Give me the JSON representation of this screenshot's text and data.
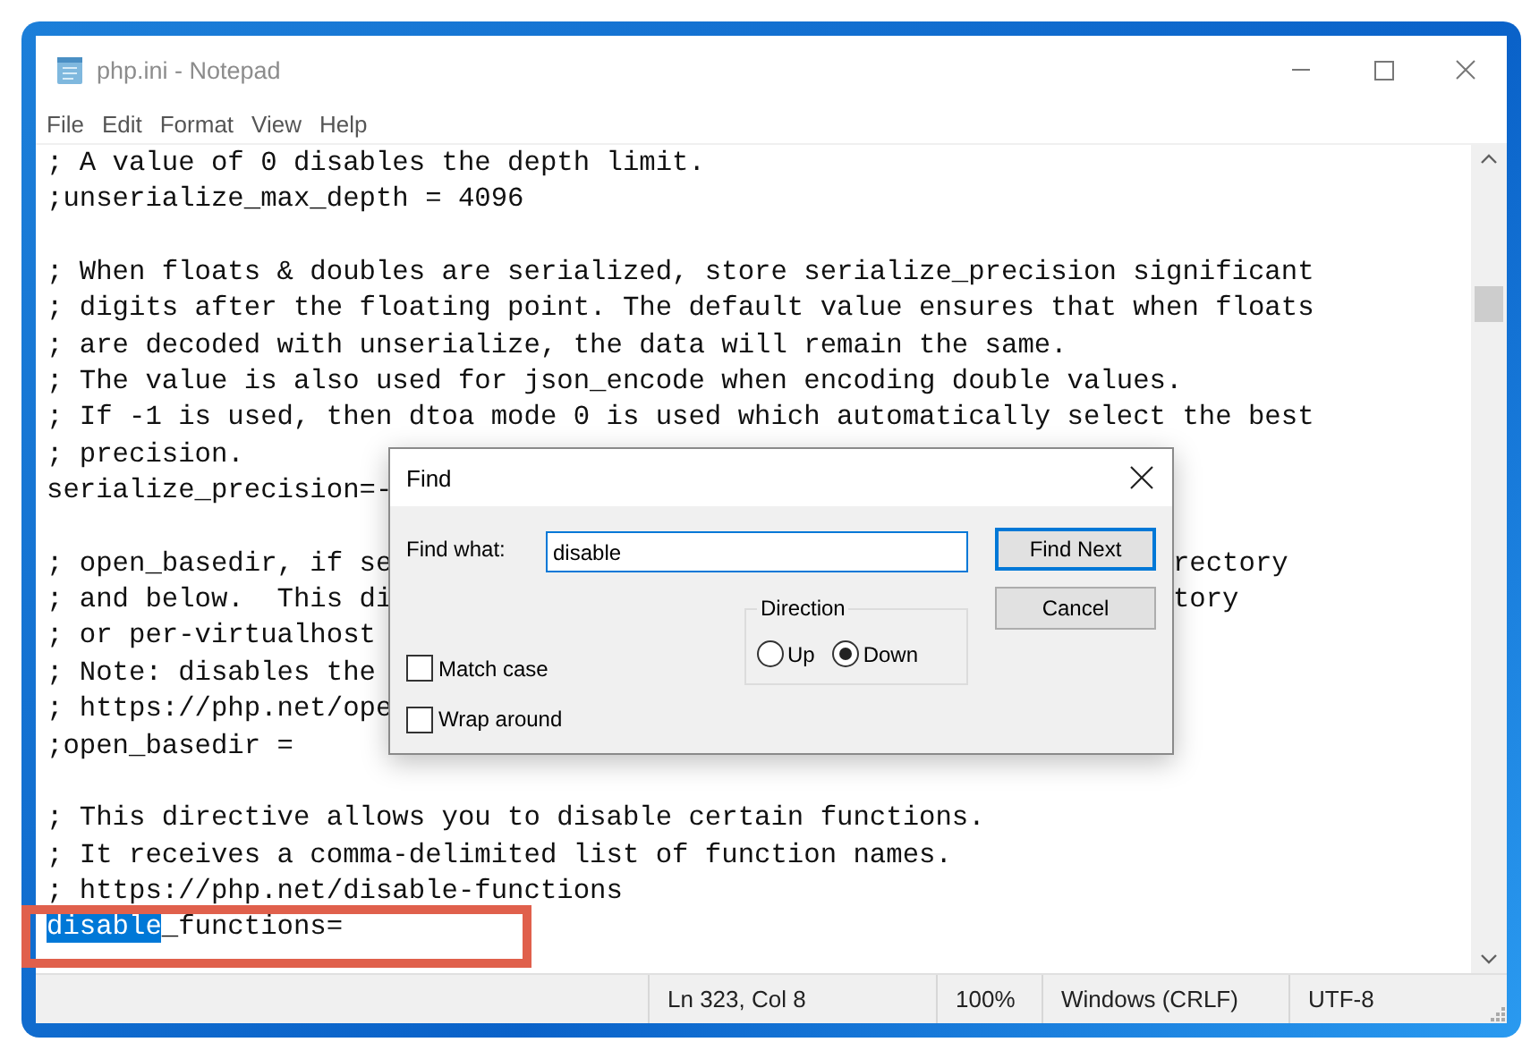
{
  "window": {
    "title": "php.ini - Notepad"
  },
  "menu": [
    "File",
    "Edit",
    "Format",
    "View",
    "Help"
  ],
  "editor": {
    "lines": [
      {
        "kind": "text",
        "text": "; A value of 0 disables the depth limit."
      },
      {
        "kind": "text",
        "text": ";unserialize_max_depth = 4096"
      },
      {
        "kind": "blank"
      },
      {
        "kind": "text",
        "text": "; When floats & doubles are serialized, store serialize_precision significant"
      },
      {
        "kind": "text",
        "text": "; digits after the floating point. The default value ensures that when floats"
      },
      {
        "kind": "text",
        "text": "; are decoded with unserialize, the data will remain the same."
      },
      {
        "kind": "text",
        "text": "; The value is also used for json_encode when encoding double values."
      },
      {
        "kind": "text",
        "text": "; If -1 is used, then dtoa mode 0 is used which automatically select the best"
      },
      {
        "kind": "text",
        "text": "; precision."
      },
      {
        "kind": "text",
        "text": "serialize_precision=-"
      },
      {
        "kind": "blank"
      },
      {
        "kind": "text",
        "text": "; open_basedir, if se",
        "tail": "rectory"
      },
      {
        "kind": "text",
        "text": "; and below.  This di",
        "tail": "tory"
      },
      {
        "kind": "text",
        "text": "; or per-virtualhost"
      },
      {
        "kind": "text",
        "text": "; Note: disables the"
      },
      {
        "kind": "text",
        "text": "; https://php.net/ope"
      },
      {
        "kind": "text",
        "text": ";open_basedir ="
      },
      {
        "kind": "blank"
      },
      {
        "kind": "text",
        "text": "; This directive allows you to disable certain functions."
      },
      {
        "kind": "text",
        "text": "; It receives a comma-delimited list of function names."
      },
      {
        "kind": "text",
        "text": "; https://php.net/disable-functions"
      },
      {
        "kind": "selection",
        "parts": [
          {
            "text": "disable",
            "selected": true
          },
          {
            "text": "_functions=",
            "selected": false
          }
        ]
      }
    ]
  },
  "status_bar": [
    "Ln 323, Col 8",
    "100%",
    "Windows (CRLF)",
    "UTF-8"
  ],
  "find_dialog": {
    "title": "Find",
    "find_what_label": "Find what:",
    "value": "disable",
    "buttons": [
      {
        "label": "Find Next",
        "default": true
      },
      {
        "label": "Cancel",
        "default": false
      }
    ],
    "direction": {
      "label": "Direction",
      "options": [
        {
          "label": "Up",
          "selected": false
        },
        {
          "label": "Down",
          "selected": true
        }
      ]
    },
    "options": [
      {
        "label": "Match case",
        "checked": false
      },
      {
        "label": "Wrap around",
        "checked": false
      }
    ]
  }
}
